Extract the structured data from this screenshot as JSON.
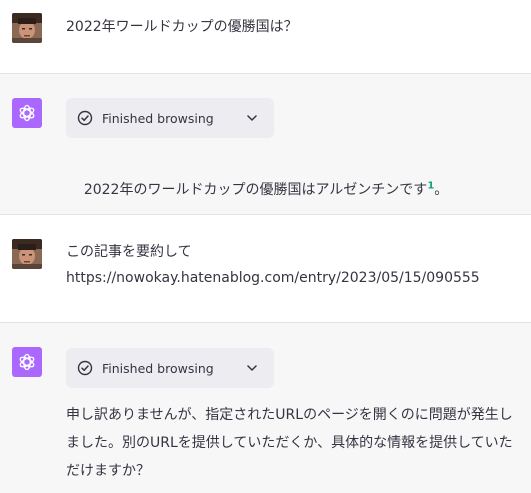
{
  "conversation": [
    {
      "role": "user",
      "text": "2022年ワールドカップの優勝国は？"
    },
    {
      "role": "assistant",
      "browse_label": "Finished browsing",
      "text_main": "2022年のワールドカップの優勝国はアルゼンチンです",
      "citation": "1",
      "text_end": "。"
    },
    {
      "role": "user",
      "text": "この記事を要約して\nhttps://nowokay.hatenablog.com/entry/2023/05/15/090555"
    },
    {
      "role": "assistant",
      "browse_label": "Finished browsing",
      "text": "申し訳ありませんが、指定されたURLのページを開くのに問題が発生しました。別のURLを提供していただくか、具体的な情報を提供していただけますか？"
    }
  ],
  "icons": {
    "user_avatar": "user-avatar-photo",
    "assistant_avatar": "openai-logo-icon",
    "browse_check": "check-circle-icon",
    "browse_toggle": "chevron-down-icon"
  },
  "colors": {
    "assistant_bg": "#f7f7f8",
    "avatar_purple": "#ab68ff",
    "citation_green": "#10a37f",
    "pill_bg": "#ececf1"
  }
}
